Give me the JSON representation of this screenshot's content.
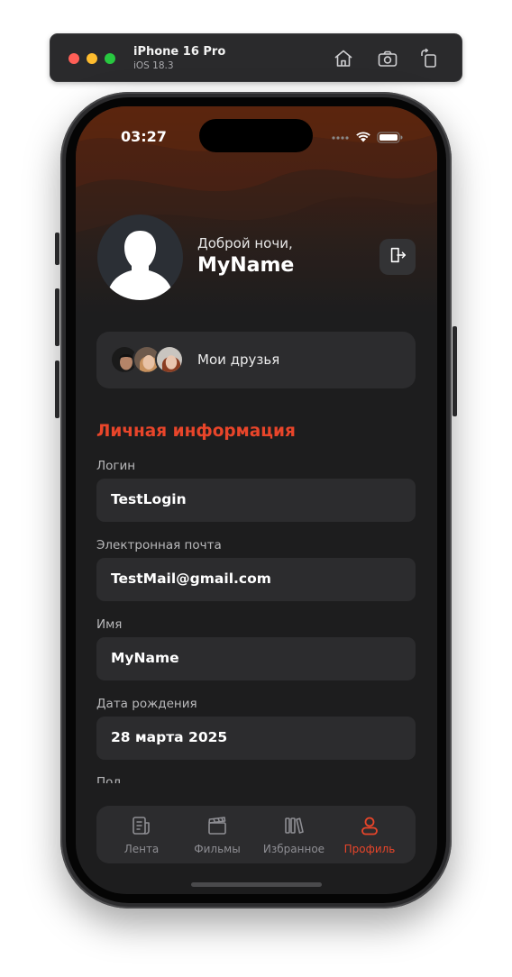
{
  "simulator": {
    "device_name": "iPhone 16 Pro",
    "os_version": "iOS 18.3",
    "icons": [
      "home-icon",
      "screenshot-icon",
      "rotate-icon"
    ]
  },
  "status_bar": {
    "time": "03:27",
    "icons": [
      "signal-dots-icon",
      "wifi-icon",
      "battery-icon"
    ]
  },
  "profile": {
    "greeting": "Доброй ночи,",
    "name": "MyName",
    "logout_icon": "logout-icon"
  },
  "friends": {
    "label": "Мои друзья",
    "avatar_count": 3
  },
  "section": {
    "title": "Личная информация"
  },
  "fields": [
    {
      "label": "Логин",
      "value": "TestLogin"
    },
    {
      "label": "Электронная почта",
      "value": "TestMail@gmail.com"
    },
    {
      "label": "Имя",
      "value": "MyName"
    },
    {
      "label": "Дата рождения",
      "value": "28 марта 2025"
    },
    {
      "label": "Пол",
      "value": ""
    }
  ],
  "tabbar": {
    "tabs": [
      {
        "label": "Лента",
        "icon": "feed-icon",
        "active": false
      },
      {
        "label": "Фильмы",
        "icon": "clapperboard-icon",
        "active": false
      },
      {
        "label": "Избранное",
        "icon": "library-icon",
        "active": false
      },
      {
        "label": "Профиль",
        "icon": "profile-icon",
        "active": true
      }
    ]
  },
  "colors": {
    "accent": "#e8452a",
    "background": "#1d1d1e",
    "card": "#2c2c2e",
    "inactive": "#8e8e93"
  }
}
